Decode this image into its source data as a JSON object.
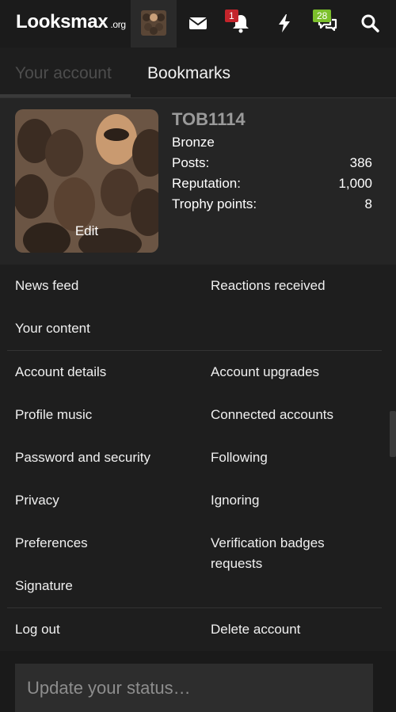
{
  "header": {
    "logo_text": "Looksmax",
    "logo_suffix": ".org",
    "icons": [
      "envelope-icon",
      "bell-icon",
      "bolt-icon",
      "chat-bubbles-icon",
      "search-icon"
    ],
    "alerts_count": "1",
    "conversations_count": "28"
  },
  "tabs": [
    {
      "label": "Your account",
      "active": false
    },
    {
      "label": "Bookmarks",
      "active": true
    }
  ],
  "profile": {
    "username": "TOB1114",
    "rank": "Bronze",
    "avatar_edit_label": "Edit",
    "stats": [
      {
        "label": "Posts:",
        "value": "386"
      },
      {
        "label": "Reputation:",
        "value": "1,000"
      },
      {
        "label": "Trophy points:",
        "value": "8"
      }
    ]
  },
  "menu": {
    "news_feed": "News feed",
    "reactions_received": "Reactions received",
    "your_content": "Your content",
    "account_details": "Account details",
    "account_upgrades": "Account upgrades",
    "profile_music": "Profile music",
    "connected_accounts": "Connected accounts",
    "password_security": "Password and security",
    "following": "Following",
    "privacy": "Privacy",
    "ignoring": "Ignoring",
    "preferences": "Preferences",
    "verification_badges": "Verification badges requests",
    "signature": "Signature",
    "log_out": "Log out",
    "delete_account": "Delete account"
  },
  "status": {
    "placeholder": "Update your status…"
  },
  "colors": {
    "background": "#1e1e1e",
    "alert_badge": "#c4242b",
    "conversation_badge": "#7cc02c"
  }
}
